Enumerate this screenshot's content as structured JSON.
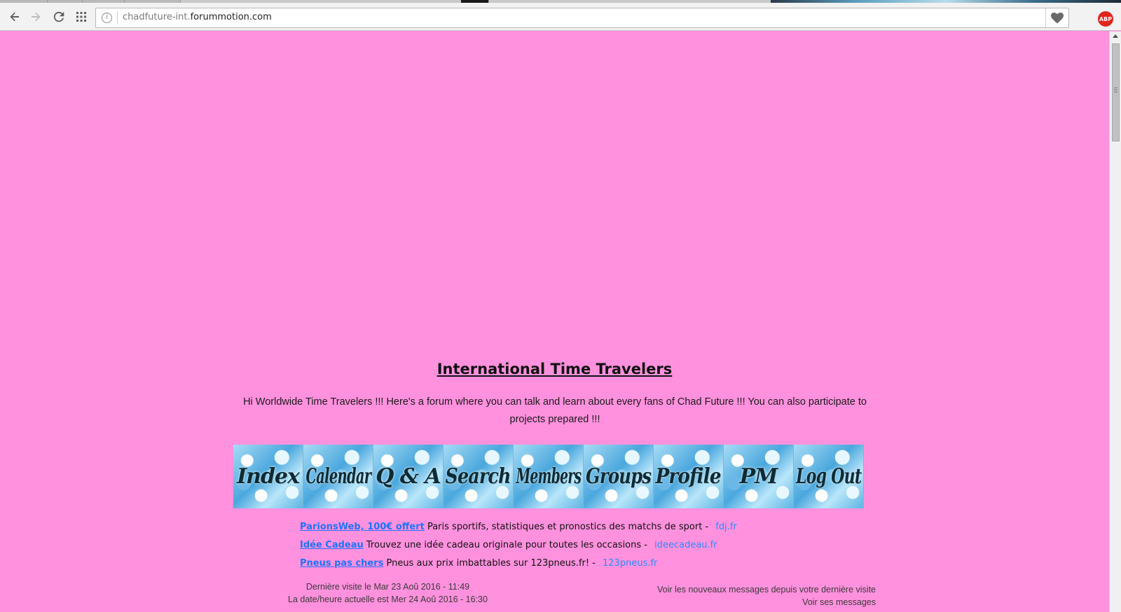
{
  "browser": {
    "url_prefix": "chadfuture-int.",
    "url_host": "forummotion.com",
    "icons": [
      "back-icon",
      "forward-icon",
      "reload-icon",
      "apps-icon",
      "info-icon",
      "heart-icon",
      "adblock-icon"
    ],
    "abp_label": "ABP"
  },
  "forum": {
    "title": "International Time Travelers",
    "description": "Hi Worldwide Time Travelers !!! Here's a forum where you can talk and learn about every fans of Chad Future !!! You can also participate to projects prepared !!!"
  },
  "nav": {
    "items": [
      {
        "label": "Index"
      },
      {
        "label": "Calendar"
      },
      {
        "label": "Q & A"
      },
      {
        "label": "Search"
      },
      {
        "label": "Members"
      },
      {
        "label": "Groups"
      },
      {
        "label": "Profile"
      },
      {
        "label": "PM"
      },
      {
        "label": "Log Out"
      }
    ]
  },
  "ads": [
    {
      "link": "ParionsWeb, 100€ offert",
      "text": " Paris sportifs, statistiques et pronostics des matchs de sport - ",
      "domain": "fdj.fr"
    },
    {
      "link": "Idée Cadeau",
      "text": " Trouvez une idée cadeau originale pour toutes les occasions - ",
      "domain": "ideecadeau.fr"
    },
    {
      "link": "Pneus pas chers",
      "text": " Pneus aux prix imbattables sur 123pneus.fr! - ",
      "domain": "123pneus.fr"
    }
  ],
  "status": {
    "last_visit": "Dernière visite le Mar 23 Aoû 2016 - 11:49",
    "current_time": "La date/heure actuelle est Mer 24 Aoû 2016 - 16:30",
    "new_messages_link": "Voir les nouveaux messages depuis votre dernière visite",
    "my_messages_link": "Voir ses messages"
  },
  "colors": {
    "page_background": "#ff91de",
    "link": "#1f73ff"
  }
}
